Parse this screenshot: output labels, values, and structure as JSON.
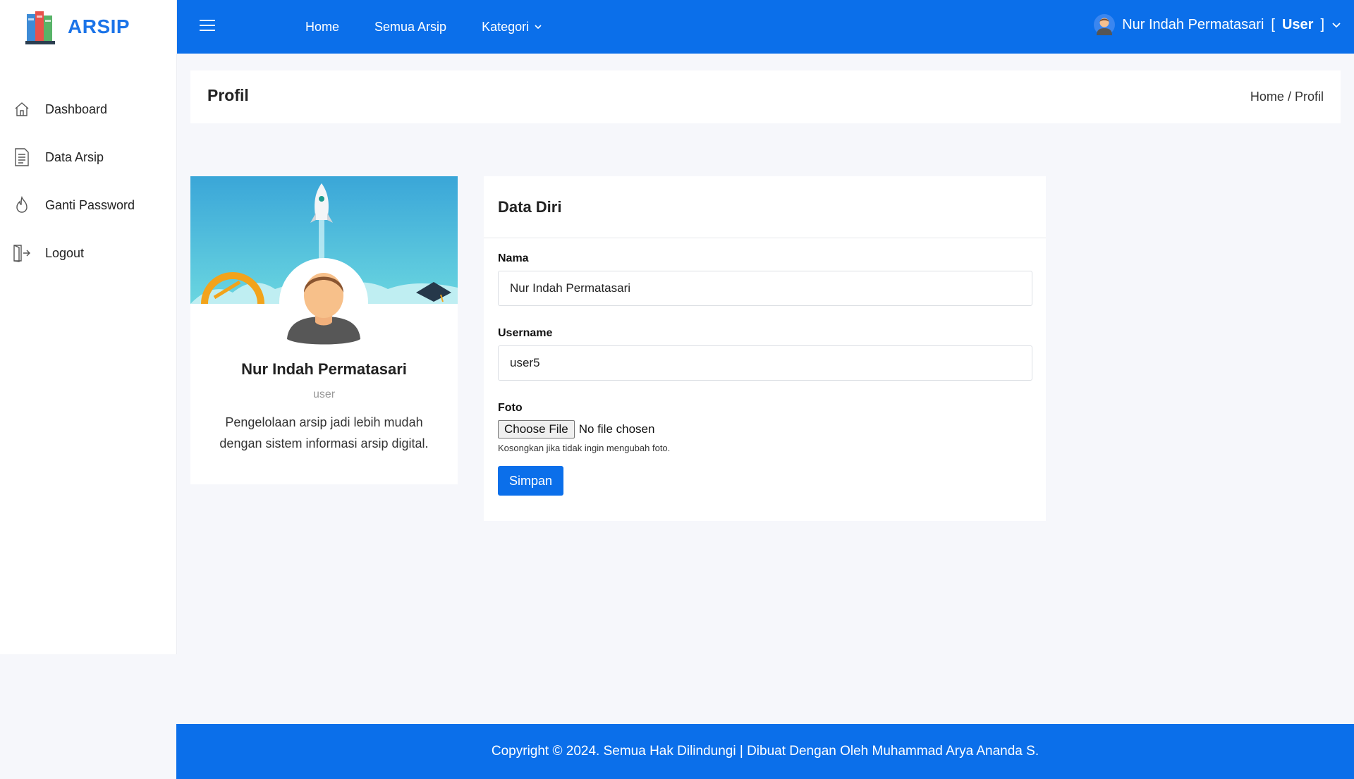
{
  "brand": {
    "name": "ARSIP"
  },
  "sidebar": {
    "items": [
      {
        "label": "Dashboard",
        "icon": "home-icon"
      },
      {
        "label": "Data Arsip",
        "icon": "document-icon"
      },
      {
        "label": "Ganti Password",
        "icon": "flame-icon"
      },
      {
        "label": "Logout",
        "icon": "logout-icon"
      }
    ]
  },
  "topbar": {
    "nav": [
      {
        "label": "Home"
      },
      {
        "label": "Semua Arsip"
      },
      {
        "label": "Kategori"
      }
    ],
    "user_name": "Nur Indah Permatasari",
    "user_role_prefix": "[",
    "user_role": "User",
    "user_role_suffix": "]"
  },
  "page": {
    "title": "Profil",
    "breadcrumb_home": "Home",
    "breadcrumb_separator": "/",
    "breadcrumb_current": "Profil"
  },
  "profile": {
    "name": "Nur Indah Permatasari",
    "role": "user",
    "description": "Pengelolaan arsip jadi lebih mudah dengan sistem informasi arsip digital."
  },
  "form": {
    "title": "Data Diri",
    "nama_label": "Nama",
    "nama_value": "Nur Indah Permatasari",
    "username_label": "Username",
    "username_value": "user5",
    "foto_label": "Foto",
    "file_button": "Choose File",
    "file_status": "No file chosen",
    "foto_help": "Kosongkan jika tidak ingin mengubah foto.",
    "submit_label": "Simpan"
  },
  "footer": {
    "text": "Copyright © 2024. Semua Hak Dilindungi | Dibuat Dengan Oleh Muhammad Arya Ananda S."
  },
  "colors": {
    "primary": "#0b6fea",
    "background": "#f6f7fb"
  }
}
